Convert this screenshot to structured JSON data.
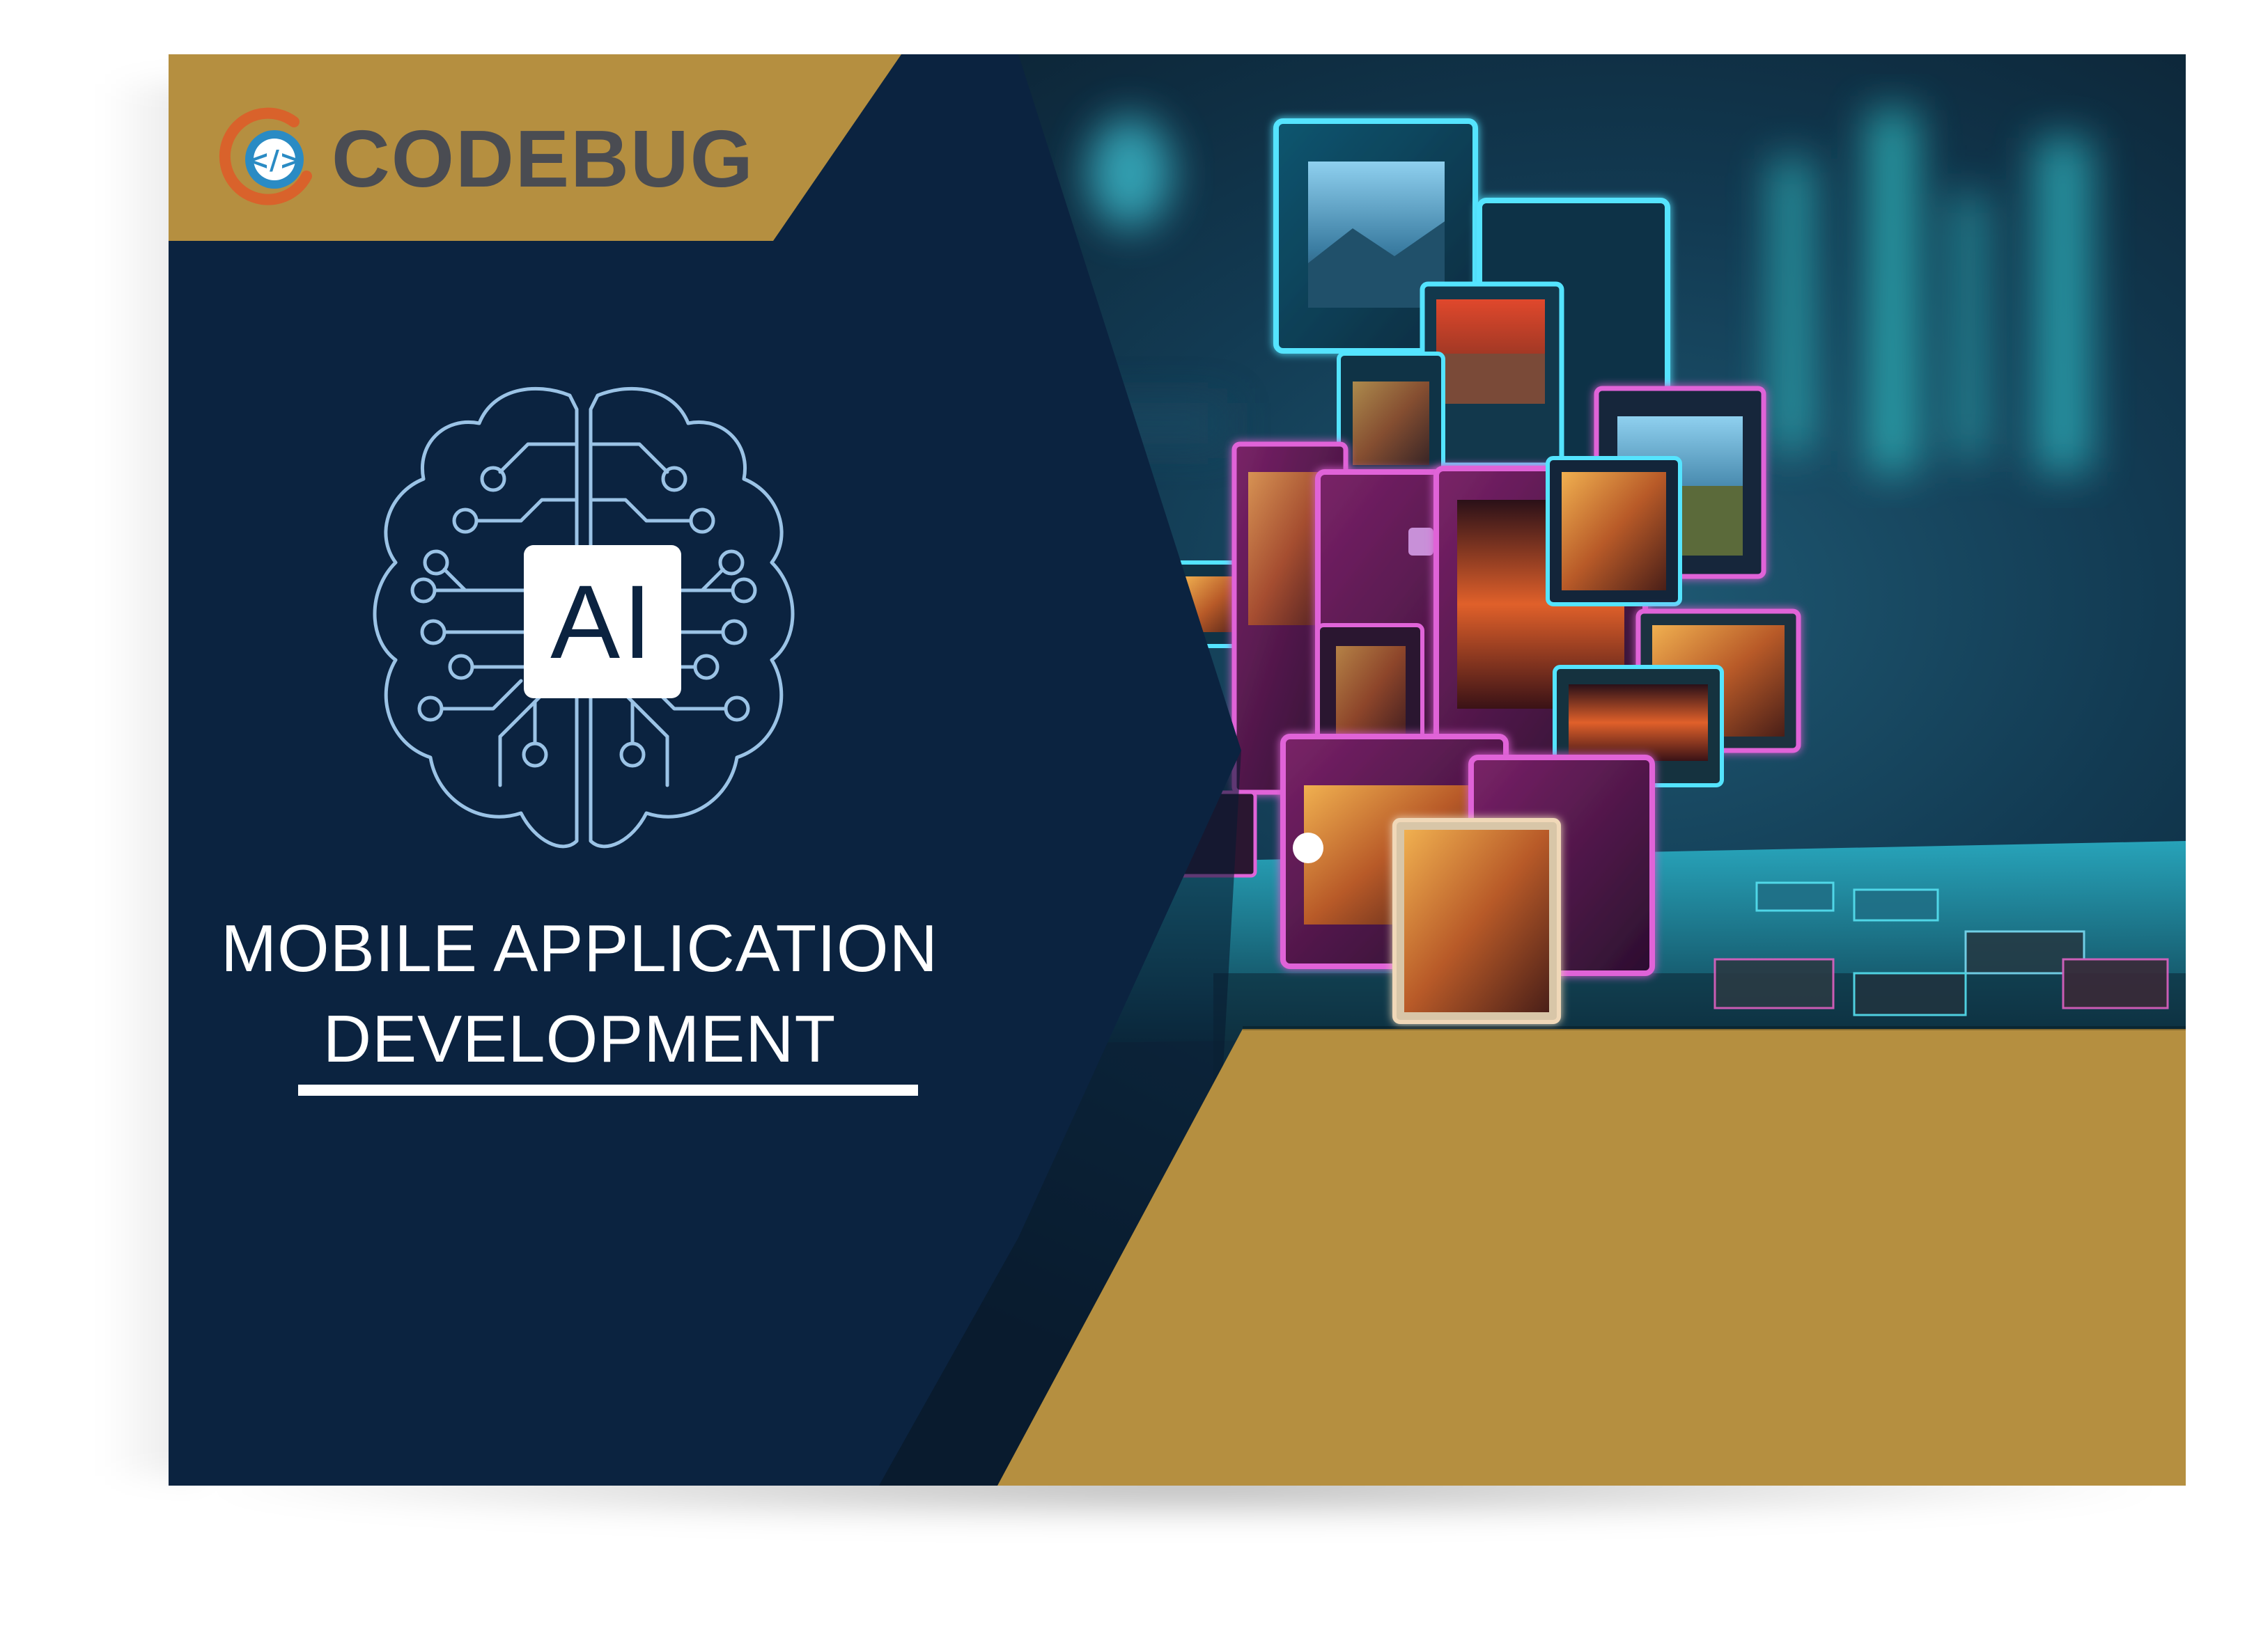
{
  "brand": {
    "name": "CODEBUG",
    "icon": "code-brackets-icon"
  },
  "badge": {
    "label": "AI",
    "icon": "brain-circuit-icon"
  },
  "heading": {
    "line1": "MOBILE APPLICATION",
    "line2": "DEVELOPMENT"
  },
  "colors": {
    "navy": "#0b2340",
    "gold": "#b58f40",
    "white": "#ffffff",
    "logo_text": "#4a4c52",
    "logo_orange": "#d9622b",
    "logo_blue": "#2a8bc4",
    "neon_cyan": "#39d6f0",
    "neon_magenta": "#e040c8"
  }
}
